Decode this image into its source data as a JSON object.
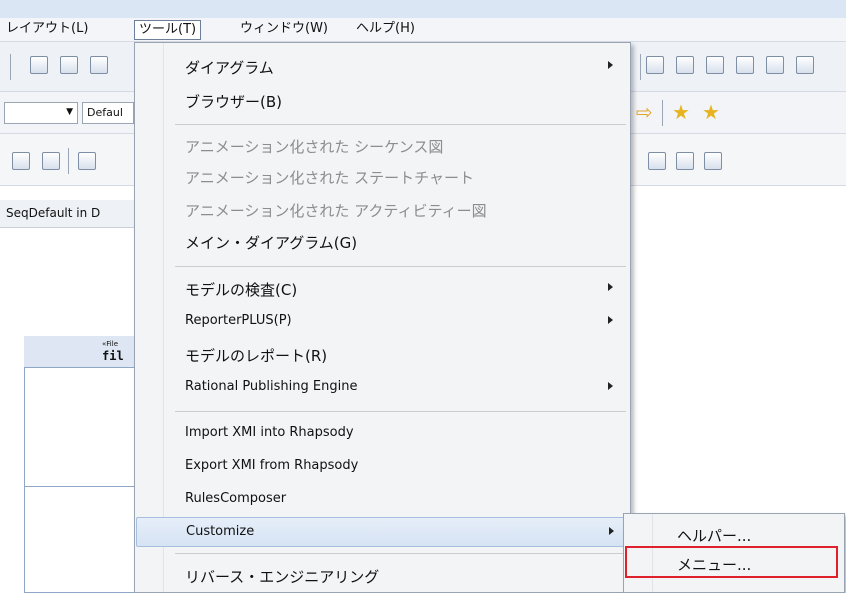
{
  "menubar": {
    "items": [
      {
        "label": "レイアウト(L)"
      },
      {
        "label": "ツール(T)"
      },
      {
        "label": "ウィンドウ(W)"
      },
      {
        "label": "ヘルプ(H)"
      }
    ]
  },
  "toolbar": {
    "combo_value": "Defaul"
  },
  "editor": {
    "tab_label": "SeqDefault in D",
    "diagram_stereotype": "«File",
    "diagram_name": "fil"
  },
  "tools_menu": {
    "items": [
      {
        "label": "ダイアグラム",
        "has_submenu": true
      },
      {
        "label": "ブラウザー(B)"
      },
      {
        "label": "アニメーション化された シーケンス図",
        "disabled": true
      },
      {
        "label": "アニメーション化された ステートチャート",
        "disabled": true
      },
      {
        "label": "アニメーション化された アクティビティー図",
        "disabled": true
      },
      {
        "label": "メイン・ダイアグラム(G)"
      },
      {
        "label": "モデルの検査(C)",
        "has_submenu": true
      },
      {
        "label": "ReporterPLUS(P)",
        "has_submenu": true
      },
      {
        "label": "モデルのレポート(R)"
      },
      {
        "label": "Rational Publishing Engine",
        "has_submenu": true
      },
      {
        "label": "Import XMI into Rhapsody"
      },
      {
        "label": "Export XMI from Rhapsody"
      },
      {
        "label": "RulesComposer"
      },
      {
        "label": "Customize",
        "has_submenu": true,
        "highlighted": true
      },
      {
        "label": "リバース・エンジニアリング"
      }
    ]
  },
  "customize_submenu": {
    "items": [
      {
        "label": "ヘルパー..."
      },
      {
        "label": "メニュー..."
      }
    ]
  },
  "colors": {
    "highlight_box": "#e0202a",
    "hover_item": "#d6e3f4"
  }
}
